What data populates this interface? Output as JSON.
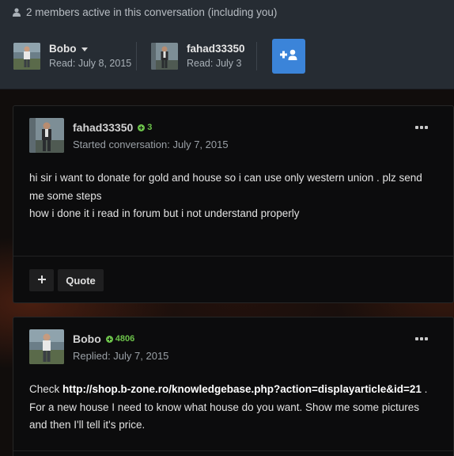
{
  "header": {
    "members_text": "2 members active in this conversation (including you)",
    "members_icon": "user-icon",
    "participants": [
      {
        "name": "Bobo",
        "read": "Read: July 8, 2015",
        "has_menu": true
      },
      {
        "name": "fahad33350",
        "read": "Read: July 3"
      }
    ],
    "add_button_icon": "add-user-icon",
    "accent_color": "#3b84d9"
  },
  "posts": [
    {
      "author": "fahad33350",
      "reputation": "3",
      "subtitle": "Started conversation: July 7, 2015",
      "body_lines": [
        "hi sir i want to donate for gold and house so i can use only western union . plz send",
        "me some steps",
        "how i done it i read in forum but i not understand properly"
      ],
      "plus_icon": "plus-icon",
      "quote_label": "Quote"
    },
    {
      "author": "Bobo",
      "reputation": "4806",
      "subtitle": "Replied: July 7, 2015",
      "body_prefix": "Check ",
      "body_link": "http://shop.b-zone.ro/knowledgebase.php?action=displayarticle&id=21",
      "body_suffix": " .",
      "body_lines": [
        "For a new house I need to know what house do you want. Show me some pictures",
        "and then I'll tell it's price."
      ]
    }
  ],
  "colors": {
    "reputation": "#6cc24a",
    "header_bg": "#262c33"
  }
}
